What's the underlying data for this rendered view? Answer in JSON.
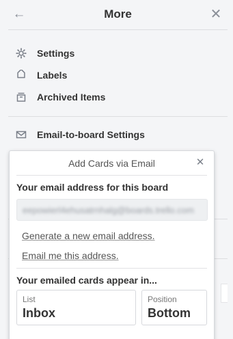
{
  "panel": {
    "title": "More",
    "back_icon": "arrow-left-icon",
    "close_icon": "close-icon",
    "items": [
      {
        "label": "Settings",
        "icon": "gear-icon"
      },
      {
        "label": "Labels",
        "icon": "tag-icon"
      },
      {
        "label": "Archived Items",
        "icon": "archive-icon"
      }
    ],
    "email_item": {
      "label": "Email-to-board Settings",
      "icon": "envelope-icon"
    }
  },
  "popover": {
    "title": "Add Cards via Email",
    "address_heading": "Your email address for this board",
    "email_value": "eepowierl4ehusatrnhalg@boards.trello.com",
    "generate_link": "Generate a new email address.",
    "email_me_link": "Email me this address.",
    "appear_heading": "Your emailed cards appear in...",
    "list": {
      "label": "List",
      "value": "Inbox"
    },
    "position": {
      "label": "Position",
      "value": "Bottom"
    }
  }
}
